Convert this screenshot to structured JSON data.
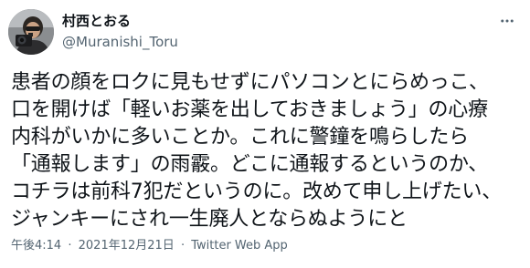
{
  "author": {
    "display_name": "村西とおる",
    "handle": "@Muranishi_Toru"
  },
  "tweet": {
    "lines": [
      "患者の顔をロクに見もせずにパソコンとにらめっこ、",
      "口を開けば「軽いお薬を出しておきましょう」の心療",
      "内科がいかに多いことか。これに警鐘を鳴らしたら",
      "「通報します」の雨霰。どこに通報するというのか、",
      "コチラは前科7犯だというのに。改めて申し上げたい、",
      "ジャンキーにされ一生廃人とならぬようにと"
    ]
  },
  "meta": {
    "time": "午後4:14",
    "date": "2021年12月21日",
    "source": "Twitter Web App",
    "separator": "·"
  },
  "icons": {
    "avatar": "profile-photo",
    "more": "more-dots-icon"
  },
  "colors": {
    "text": "#0f1419",
    "secondary": "#536471",
    "background": "#ffffff"
  }
}
